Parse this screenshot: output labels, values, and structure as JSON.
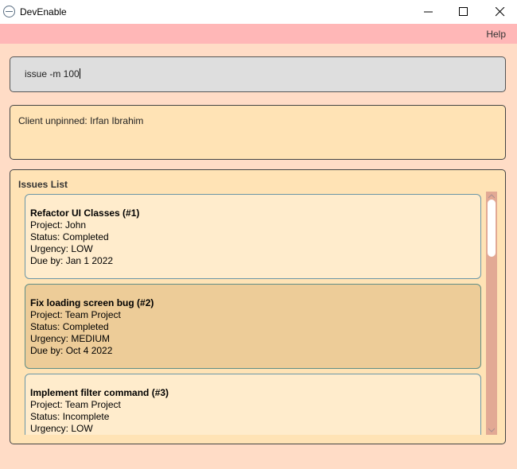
{
  "window": {
    "title": "DevEnable",
    "icon": "app-circle-icon"
  },
  "menubar": {
    "help_label": "Help"
  },
  "command": {
    "value": "issue -m 100"
  },
  "result": {
    "text": "Client unpinned: Irfan Ibrahim"
  },
  "issues": {
    "title": "Issues List",
    "items": [
      {
        "title": "Refactor UI Classes (#1)",
        "project": "Project: John",
        "status": "Status: Completed",
        "urgency": "Urgency: LOW",
        "due": "Due by: Jan 1 2022",
        "selected": false
      },
      {
        "title": "Fix loading screen bug (#2)",
        "project": "Project: Team Project",
        "status": "Status: Completed",
        "urgency": "Urgency: MEDIUM",
        "due": "Due by: Oct 4 2022",
        "selected": true
      },
      {
        "title": "Implement filter command (#3)",
        "project": "Project: Team Project",
        "status": "Status: Incomplete",
        "urgency": "Urgency: LOW",
        "due": "",
        "selected": false
      }
    ]
  },
  "colors": {
    "background": "#ffdcc6",
    "menubar": "#ffb7b7",
    "panel": "#ffe3b5",
    "card": "#ffeccc",
    "card_selected": "#edcc98",
    "scrollbar_track": "#e2a994"
  }
}
